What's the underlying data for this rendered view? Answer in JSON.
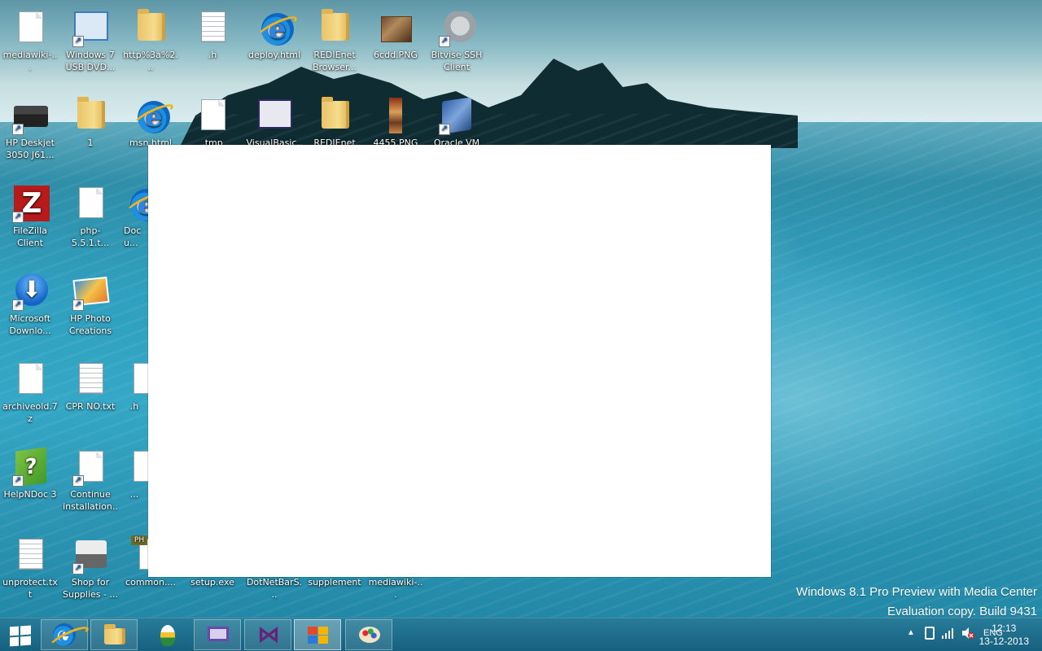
{
  "desktop": {
    "icons": [
      {
        "label": "mediawiki-...",
        "glyph": "blank-file-icon"
      },
      {
        "label": "Windows 7 USB DVD...",
        "glyph": "usb-installer-icon"
      },
      {
        "label": "http%3a%2...",
        "glyph": "folder-icon"
      },
      {
        "label": ".h",
        "glyph": "text-file-icon"
      },
      {
        "label": "deploy.html",
        "glyph": "internet-explorer-icon"
      },
      {
        "label": "REDIEnet Browser...",
        "glyph": "folder-icon"
      },
      {
        "label": "6cdd.PNG",
        "glyph": "image-file-icon"
      },
      {
        "label": "Bitvise SSH Client",
        "glyph": "bitvise-ssh-icon"
      },
      {
        "label": "HP Deskjet 3050 J61...",
        "glyph": "printer-icon"
      },
      {
        "label": "1",
        "glyph": "folder-icon"
      },
      {
        "label": "msn.html",
        "glyph": "internet-explorer-icon"
      },
      {
        "label": ".tmp",
        "glyph": "blank-file-icon"
      },
      {
        "label": "VisualBasic...",
        "glyph": "visual-basic-icon"
      },
      {
        "label": "REDIEnet",
        "glyph": "folder-icon"
      },
      {
        "label": "4455.PNG",
        "glyph": "image-file-icon"
      },
      {
        "label": "Oracle VM",
        "glyph": "virtualbox-icon"
      },
      {
        "label": "FileZilla Client",
        "glyph": "filezilla-icon"
      },
      {
        "label": "php-5.5.1.t...",
        "glyph": "blank-file-icon"
      },
      {
        "label": "Docu...",
        "glyph": "internet-explorer-icon"
      },
      {
        "label": "Microsoft Downlo...",
        "glyph": "download-manager-icon"
      },
      {
        "label": "HP Photo Creations",
        "glyph": "photo-icon"
      },
      {
        "label": "archiveold.7z",
        "glyph": "blank-file-icon"
      },
      {
        "label": "CPR NO.txt",
        "glyph": "text-file-icon"
      },
      {
        "label": ".h",
        "glyph": "blank-file-icon"
      },
      {
        "label": "HelpNDoc 3",
        "glyph": "helpndoc-icon"
      },
      {
        "label": "Continue installation...",
        "glyph": "blank-file-icon"
      },
      {
        "label": "...",
        "glyph": "blank-file-icon"
      },
      {
        "label": "unprotect.txt",
        "glyph": "text-file-icon"
      },
      {
        "label": "Shop for Supplies - ...",
        "glyph": "shop-printer-icon"
      },
      {
        "label": "common....",
        "glyph": "php-file-icon"
      },
      {
        "label": "setup.exe",
        "glyph": "exe-icon"
      },
      {
        "label": "DotNetBarS...",
        "glyph": "exe-icon"
      },
      {
        "label": "supplement",
        "glyph": "folder-icon"
      },
      {
        "label": "mediawiki-...",
        "glyph": "blank-file-icon"
      }
    ]
  },
  "watermark": {
    "line1": "Windows 8.1 Pro Preview with Media Center",
    "line2": "Evaluation copy. Build 9431"
  },
  "taskbar": {
    "buttons": [
      {
        "name": "internet-explorer-taskbar-icon"
      },
      {
        "name": "file-explorer-taskbar-icon"
      },
      {
        "name": "winamp-taskbar-icon"
      },
      {
        "name": "remote-desktop-taskbar-icon"
      },
      {
        "name": "visual-studio-taskbar-icon"
      },
      {
        "name": "control-panel-taskbar-icon"
      },
      {
        "name": "paint-taskbar-icon"
      }
    ],
    "tray": {
      "language": "ENG",
      "time": "12:13",
      "date": "13-12-2013"
    }
  },
  "colors": {
    "taskbar": "#1e6f8f",
    "window": "#ffffff",
    "watermark_text": "#ffffff"
  }
}
